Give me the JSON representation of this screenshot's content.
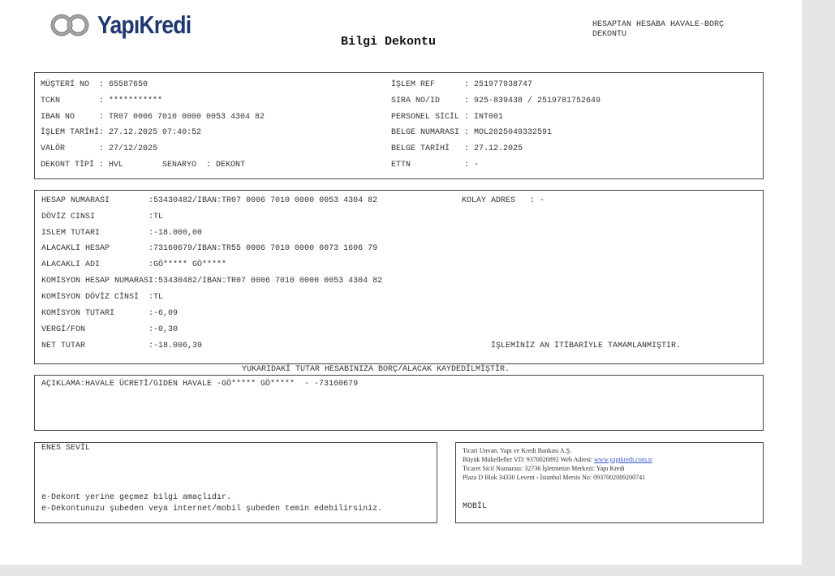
{
  "header": {
    "brand": "YapıKredi",
    "title": "Bilgi Dekontu",
    "doc_type": "HESAPTAN HESABA HAVALE-BORÇ DEKONTU"
  },
  "customer": {
    "left": [
      {
        "label": "MÜŞTERİ NO  ",
        "value": ": 65587650"
      },
      {
        "label": "TCKN        ",
        "value": ": ***********"
      },
      {
        "label": "IBAN NO     ",
        "value": ": TR07 0006 7010 0000 0053 4304 82"
      },
      {
        "label": "İŞLEM TARİHİ",
        "value": ": 27.12.2025 07:40:52"
      },
      {
        "label": "VALÖR       ",
        "value": ": 27/12/2025"
      },
      {
        "label": "DEKONT TİPİ ",
        "value": ": HVL        SENARYO  : DEKONT"
      }
    ],
    "right": [
      {
        "label": "İŞLEM REF      ",
        "value": ": 251977938747"
      },
      {
        "label": "SIRA NO/ID     ",
        "value": ": 925-839438 / 2519781752649"
      },
      {
        "label": "PERSONEL SİCİL ",
        "value": ": INT001"
      },
      {
        "label": "BELGE NUMARASI ",
        "value": ": MOL2025049332591"
      },
      {
        "label": "BELGE TARİHİ   ",
        "value": ": 27.12.2025"
      },
      {
        "label": "ETTN           ",
        "value": ": -"
      }
    ]
  },
  "transaction": {
    "rows": [
      {
        "label": "HESAP NUMARASI        ",
        "value": ":53430482/IBAN:TR07 0006 7010 0000 0053 4304 82"
      },
      {
        "label": "DÖVİZ CINSI           ",
        "value": ":TL"
      },
      {
        "label": "ISLEM TUTARI          ",
        "value": ":-18.000,00"
      },
      {
        "label": "ALACAKLI HESAP        ",
        "value": ":73160679/IBAN:TR55 0006 7010 0000 0073 1606 79"
      },
      {
        "label": "ALACAKLI ADI          ",
        "value": ":GÖ***** GÖ*****"
      },
      {
        "label": "KOMİSYON HESAP NUMARASI",
        "value": ":53430482/IBAN:TR07 0006 7010 0000 0053 4304 82"
      },
      {
        "label": "KOMİSYON DÖVİZ CİNSİ  ",
        "value": ":TL"
      },
      {
        "label": "KOMİSYON TUTARI       ",
        "value": ":-6,09"
      },
      {
        "label": "VERGİ/FON             ",
        "value": ":-0,30"
      },
      {
        "label": "NET TUTAR             ",
        "value": ":-18.006,39"
      }
    ],
    "kolay_adres": "KOLAY ADRES   : -",
    "status": "İŞLEMİNİZ AN İTİBARİYLE TAMAMLANMIŞTIR."
  },
  "footer_note": "YUKARIDAKİ TUTAR HESABINIZA BORÇ/ALACAK KAYDEDİLMİŞTİR.",
  "description": "AÇIKLAMA:HAVALE ÜCRETİ/GIDEN HAVALE -GÖ***** GÖ*****  - -73160679",
  "signature": {
    "name": "ENES SEVİL",
    "note1": "e-Dekont yerine geçmez bilgi amaçlıdır.",
    "note2": "e-Dekontunuzu şubeden veya internet/mobil şubeden temin edebilirsiniz."
  },
  "legal": {
    "line1": "Ticari Unvan: Yapı ve Kredi Bankası A.Ş.",
    "line2_prefix": "Büyük Mükellefler VD: 9370020892 Web Adresi: ",
    "website": "www.yapikredi.com.tr",
    "line3": "Ticaret Sicil Numarası: 32736 İşletmenin Merkezi: Yapı Kredi",
    "line4": "Plaza D Blok 34330 Levent - İstanbul Mersis No: 0937002089200741",
    "channel": "MOBİL"
  },
  "colors": {
    "brand": "#1f3970",
    "link": "#3355cc"
  }
}
